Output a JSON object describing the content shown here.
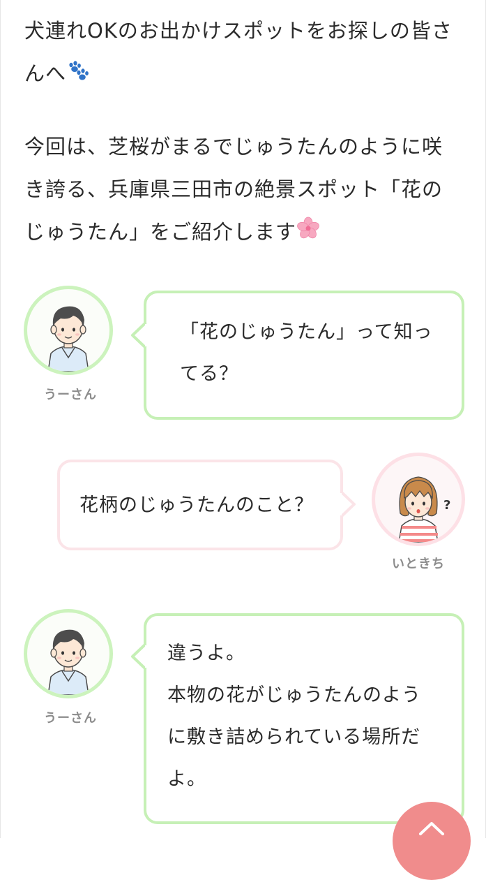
{
  "intro": {
    "line1": "犬連れOKのお出かけスポットをお探しの皆さ",
    "line2": "んへ",
    "paw_icon": "paw-prints-icon",
    "para2_line1": "今回は、芝桜がまるでじゅうたんのように咲",
    "para2_line2": "き誇る、兵庫県三田市の絶景スポット「花の",
    "para2_line3": "じゅうたん」をご紹介します",
    "blossom_icon": "cherry-blossom-icon"
  },
  "dialogue": [
    {
      "speaker": "うーさん",
      "side": "left",
      "theme_color": "#c6f0b6",
      "lines": [
        "「花のじゅうたん」って知っ",
        "てる？"
      ]
    },
    {
      "speaker": "いときち",
      "side": "right",
      "theme_color": "#fbe4e8",
      "lines": [
        "花柄のじゅうたんのこと？"
      ]
    },
    {
      "speaker": "うーさん",
      "side": "left",
      "theme_color": "#c6f0b6",
      "lines": [
        "違うよ。",
        "本物の花がじゅうたんのよう",
        "に敷き詰められている場所だ",
        "よ。"
      ]
    }
  ],
  "scroll_top": {
    "icon": "chevron-up-icon",
    "color": "#f08c8c"
  }
}
